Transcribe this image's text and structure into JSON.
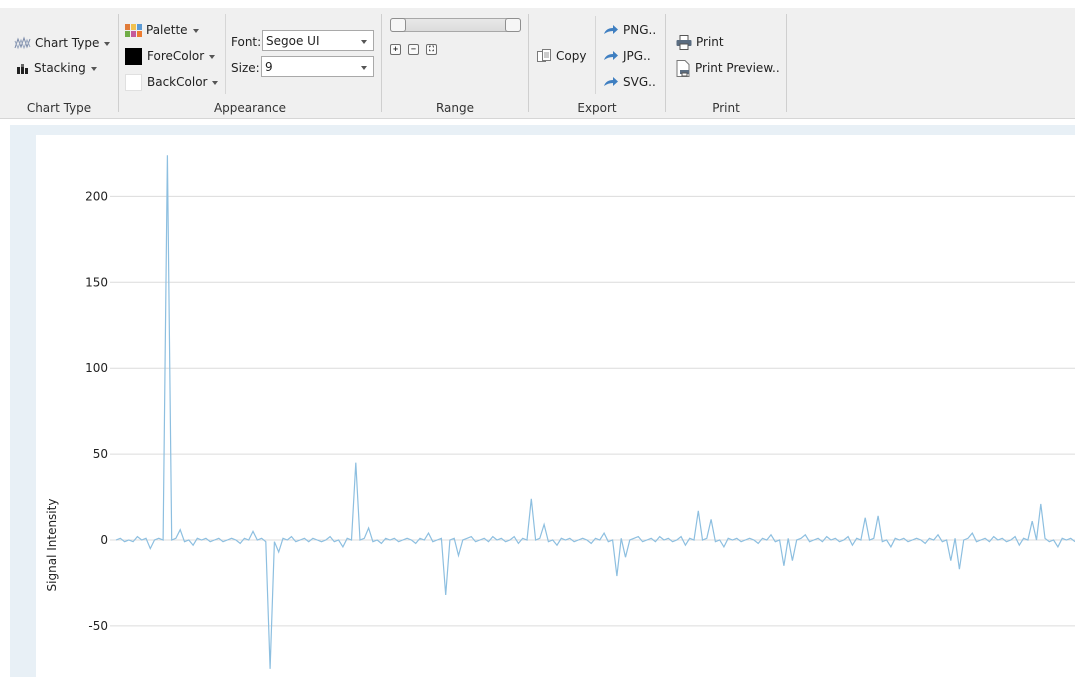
{
  "ribbon": {
    "chart_type_group": {
      "chart_type_label": "Chart Type",
      "stacking_label": "Stacking",
      "group_label": "Chart Type"
    },
    "appearance_group": {
      "palette_label": "Palette",
      "forecolor_label": "ForeColor",
      "backcolor_label": "BackColor",
      "forecolor": "#000000",
      "backcolor": "#ffffff",
      "font_label": "Font:",
      "font_value": "Segoe UI",
      "size_label": "Size:",
      "size_value": "9",
      "group_label": "Appearance"
    },
    "range_group": {
      "group_label": "Range",
      "zoom_in_glyph": "+",
      "zoom_out_glyph": "−",
      "zoom_fit_glyph": "⛶"
    },
    "export_group": {
      "copy_label": "Copy",
      "png_label": "PNG..",
      "jpg_label": "JPG..",
      "svg_label": "SVG..",
      "group_label": "Export"
    },
    "print_group": {
      "print_label": "Print",
      "print_preview_label": "Print Preview..",
      "group_label": "Print"
    }
  },
  "chart_data": {
    "type": "line",
    "title": "",
    "xlabel": "",
    "ylabel": "Signal Intensity",
    "ylim": [
      -75,
      225
    ],
    "yticks": [
      200,
      150,
      100,
      50,
      0,
      -50
    ],
    "ytick_labels": [
      "200",
      "150",
      "100",
      "50",
      "0",
      "-50"
    ],
    "grid": true,
    "line_color": "#8dbfe0",
    "series": [
      {
        "values": [
          0,
          1,
          -1,
          0,
          -1,
          2,
          0,
          1,
          -5,
          0,
          1,
          0,
          224,
          0,
          1,
          6,
          -1,
          0,
          -3,
          1,
          0,
          1,
          -1,
          0,
          1,
          -1,
          0,
          1,
          0,
          -2,
          1,
          0,
          5,
          0,
          1,
          -1,
          -75,
          -1,
          -7,
          1,
          0,
          2,
          -1,
          0,
          1,
          -1,
          1,
          0,
          -1,
          0,
          2,
          -1,
          0,
          -4,
          1,
          0,
          45,
          0,
          1,
          7,
          -1,
          0,
          -2,
          1,
          0,
          1,
          -1,
          0,
          1,
          0,
          -2,
          1,
          0,
          4,
          -1,
          0,
          1,
          -32,
          0,
          1,
          -9,
          0,
          1,
          2,
          -1,
          0,
          1,
          -1,
          2,
          0,
          1,
          -1,
          0,
          2,
          -2,
          1,
          0,
          24,
          0,
          1,
          9,
          -1,
          0,
          -3,
          1,
          0,
          1,
          -1,
          0,
          1,
          0,
          -2,
          1,
          0,
          4,
          -1,
          0,
          -21,
          1,
          -10,
          0,
          1,
          2,
          -1,
          0,
          1,
          -1,
          2,
          0,
          1,
          -1,
          0,
          2,
          -3,
          1,
          0,
          17,
          0,
          1,
          12,
          -1,
          0,
          -4,
          1,
          0,
          1,
          -1,
          0,
          1,
          0,
          -2,
          1,
          0,
          3,
          -1,
          0,
          -15,
          1,
          -12,
          0,
          1,
          3,
          -1,
          0,
          1,
          -1,
          2,
          0,
          1,
          -1,
          0,
          2,
          -3,
          1,
          0,
          13,
          0,
          1,
          14,
          -1,
          0,
          -4,
          1,
          0,
          1,
          -1,
          0,
          1,
          0,
          -2,
          1,
          0,
          3,
          -1,
          0,
          -12,
          1,
          -17,
          0,
          1,
          4,
          -1,
          0,
          1,
          -1,
          2,
          0,
          1,
          -1,
          0,
          2,
          -3,
          1,
          0,
          11,
          0,
          21,
          1,
          -1,
          0,
          -4,
          1,
          0,
          1,
          -1
        ]
      }
    ]
  }
}
